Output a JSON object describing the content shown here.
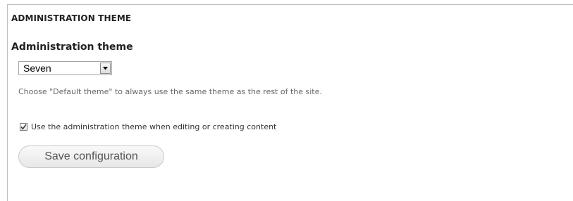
{
  "section": {
    "title": "ADMINISTRATION THEME"
  },
  "theme_field": {
    "label": "Administration theme",
    "selected_value": "Seven",
    "arrow_icon": "triangle-down-icon",
    "description": "Choose \"Default theme\" to always use the same theme as the rest of the site."
  },
  "node_admin_option": {
    "checked": true,
    "label": "Use the administration theme when editing or creating content",
    "check_icon": "checkmark-icon"
  },
  "actions": {
    "save_label": "Save configuration"
  }
}
